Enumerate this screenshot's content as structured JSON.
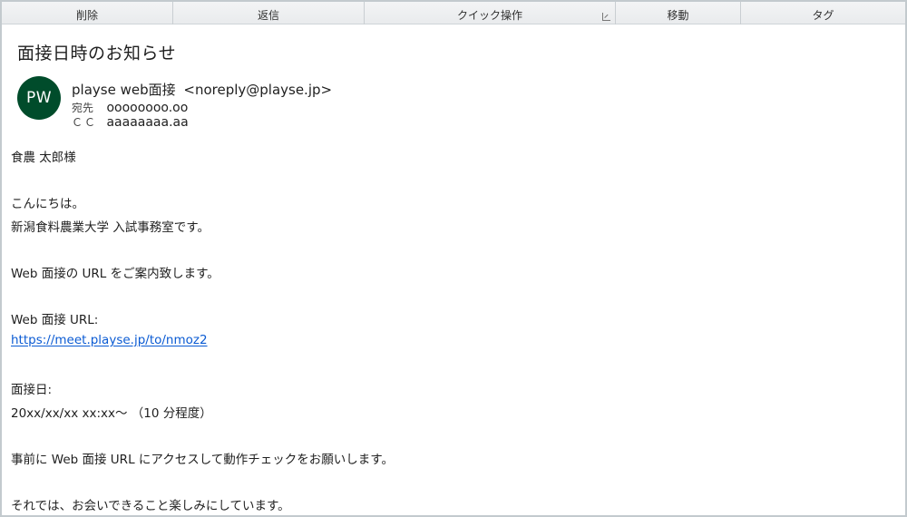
{
  "ribbon": {
    "groups": [
      {
        "label": "削除"
      },
      {
        "label": "返信"
      },
      {
        "label": "クイック操作"
      },
      {
        "label": "移動"
      },
      {
        "label": "タグ"
      }
    ]
  },
  "email": {
    "subject": "面接日時のお知らせ",
    "avatar_initials": "PW",
    "avatar_color": "#004c2b",
    "sender_name": "playse web面接",
    "sender_address": "<noreply@playse.jp>",
    "to_label": "宛先",
    "to_value": "oooooooo.oo",
    "cc_label": "ＣＣ",
    "cc_value": "aaaaaaaa.aa",
    "body": {
      "greeting_name": "食農  太郎様",
      "hello": "こんにちは。",
      "intro": "新潟食料農業大学 入試事務室です。",
      "announce": "Web 面接の URL をご案内致します。",
      "url_label": "Web 面接 URL:",
      "url_link": "https://meet.playse.jp/to/nmoz2",
      "date_label": "面接日:",
      "date_value": "20xx/xx/xx  xx:xx〜  （10 分程度）",
      "request": "事前に Web 面接 URL にアクセスして動作チェックをお願いします。",
      "closing": "それでは、お会いできること楽しみにしています。"
    },
    "link_color": "#0b5bd3"
  }
}
